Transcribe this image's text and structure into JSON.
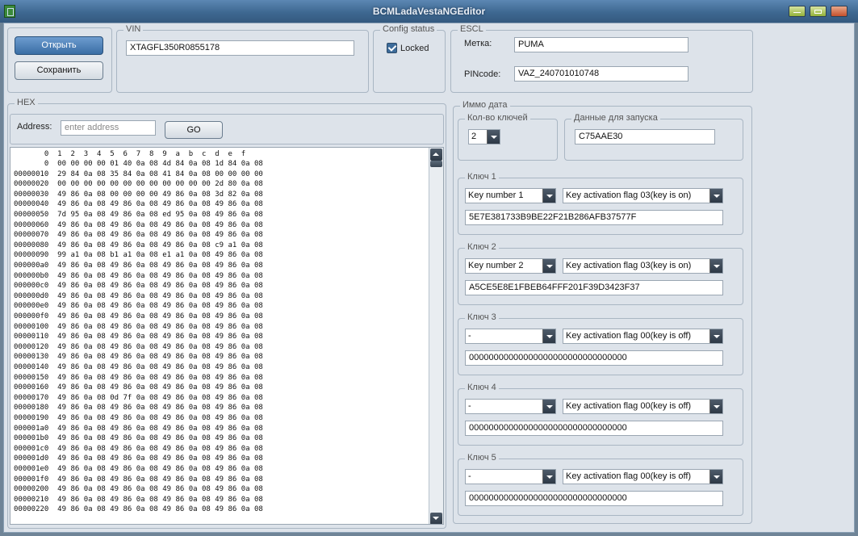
{
  "window": {
    "title": "BCMLadaVestaNGEditor"
  },
  "file": {
    "open_label": "Открыть",
    "save_label": "Сохранить"
  },
  "vin": {
    "caption": "VIN",
    "value": "XTAGFL350R0855178"
  },
  "config": {
    "caption": "Config status",
    "locked_label": "Locked",
    "locked": true
  },
  "escl": {
    "caption": "ESCL",
    "label_label": "Метка:",
    "label_value": "PUMA",
    "pin_label": "PINcode:",
    "pin_value": "VAZ_240701010748"
  },
  "hex": {
    "caption": "HEX",
    "address_label": "Address:",
    "address_placeholder": "enter address",
    "go_label": "GO",
    "header": "       0  1  2  3  4  5  6  7  8  9  a  b  c  d  e  f",
    "rows": [
      "       0  00 00 00 00 01 40 0a 08 4d 84 0a 08 1d 84 0a 08",
      "00000010  29 84 0a 08 35 84 0a 08 41 84 0a 08 00 00 00 00",
      "00000020  00 00 00 00 00 00 00 00 00 00 00 00 2d 80 0a 08",
      "00000030  49 86 0a 08 00 00 00 00 49 86 0a 08 3d 82 0a 08",
      "00000040  49 86 0a 08 49 86 0a 08 49 86 0a 08 49 86 0a 08",
      "00000050  7d 95 0a 08 49 86 0a 08 ed 95 0a 08 49 86 0a 08",
      "00000060  49 86 0a 08 49 86 0a 08 49 86 0a 08 49 86 0a 08",
      "00000070  49 86 0a 08 49 86 0a 08 49 86 0a 08 49 86 0a 08",
      "00000080  49 86 0a 08 49 86 0a 08 49 86 0a 08 c9 a1 0a 08",
      "00000090  99 a1 0a 08 b1 a1 0a 08 e1 a1 0a 08 49 86 0a 08",
      "000000a0  49 86 0a 08 49 86 0a 08 49 86 0a 08 49 86 0a 08",
      "000000b0  49 86 0a 08 49 86 0a 08 49 86 0a 08 49 86 0a 08",
      "000000c0  49 86 0a 08 49 86 0a 08 49 86 0a 08 49 86 0a 08",
      "000000d0  49 86 0a 08 49 86 0a 08 49 86 0a 08 49 86 0a 08",
      "000000e0  49 86 0a 08 49 86 0a 08 49 86 0a 08 49 86 0a 08",
      "000000f0  49 86 0a 08 49 86 0a 08 49 86 0a 08 49 86 0a 08",
      "00000100  49 86 0a 08 49 86 0a 08 49 86 0a 08 49 86 0a 08",
      "00000110  49 86 0a 08 49 86 0a 08 49 86 0a 08 49 86 0a 08",
      "00000120  49 86 0a 08 49 86 0a 08 49 86 0a 08 49 86 0a 08",
      "00000130  49 86 0a 08 49 86 0a 08 49 86 0a 08 49 86 0a 08",
      "00000140  49 86 0a 08 49 86 0a 08 49 86 0a 08 49 86 0a 08",
      "00000150  49 86 0a 08 49 86 0a 08 49 86 0a 08 49 86 0a 08",
      "00000160  49 86 0a 08 49 86 0a 08 49 86 0a 08 49 86 0a 08",
      "00000170  49 86 0a 08 0d 7f 0a 08 49 86 0a 08 49 86 0a 08",
      "00000180  49 86 0a 08 49 86 0a 08 49 86 0a 08 49 86 0a 08",
      "00000190  49 86 0a 08 49 86 0a 08 49 86 0a 08 49 86 0a 08",
      "000001a0  49 86 0a 08 49 86 0a 08 49 86 0a 08 49 86 0a 08",
      "000001b0  49 86 0a 08 49 86 0a 08 49 86 0a 08 49 86 0a 08",
      "000001c0  49 86 0a 08 49 86 0a 08 49 86 0a 08 49 86 0a 08",
      "000001d0  49 86 0a 08 49 86 0a 08 49 86 0a 08 49 86 0a 08",
      "000001e0  49 86 0a 08 49 86 0a 08 49 86 0a 08 49 86 0a 08",
      "000001f0  49 86 0a 08 49 86 0a 08 49 86 0a 08 49 86 0a 08",
      "00000200  49 86 0a 08 49 86 0a 08 49 86 0a 08 49 86 0a 08",
      "00000210  49 86 0a 08 49 86 0a 08 49 86 0a 08 49 86 0a 08",
      "00000220  49 86 0a 08 49 86 0a 08 49 86 0a 08 49 86 0a 08"
    ]
  },
  "immo": {
    "caption": "Иммо дата",
    "key_count_caption": "Кол-во ключей",
    "key_count_value": "2",
    "start_data_caption": "Данные для запуска",
    "start_data_value": "C75AAE30",
    "keys": [
      {
        "caption": "Ключ 1",
        "number": "Key number 1",
        "flag": "Key activation flag 03(key is on)",
        "data": "5E7E381733B9BE22F21B286AFB37577F"
      },
      {
        "caption": "Ключ 2",
        "number": "Key number 2",
        "flag": "Key activation flag 03(key is on)",
        "data": "A5CE5E8E1FBEB64FFF201F39D3423F37"
      },
      {
        "caption": "Ключ 3",
        "number": "-",
        "flag": "Key activation flag 00(key is off)",
        "data": "00000000000000000000000000000000"
      },
      {
        "caption": "Ключ 4",
        "number": "-",
        "flag": "Key activation flag 00(key is off)",
        "data": "00000000000000000000000000000000"
      },
      {
        "caption": "Ключ 5",
        "number": "-",
        "flag": "Key activation flag 00(key is off)",
        "data": "00000000000000000000000000000000"
      }
    ]
  }
}
